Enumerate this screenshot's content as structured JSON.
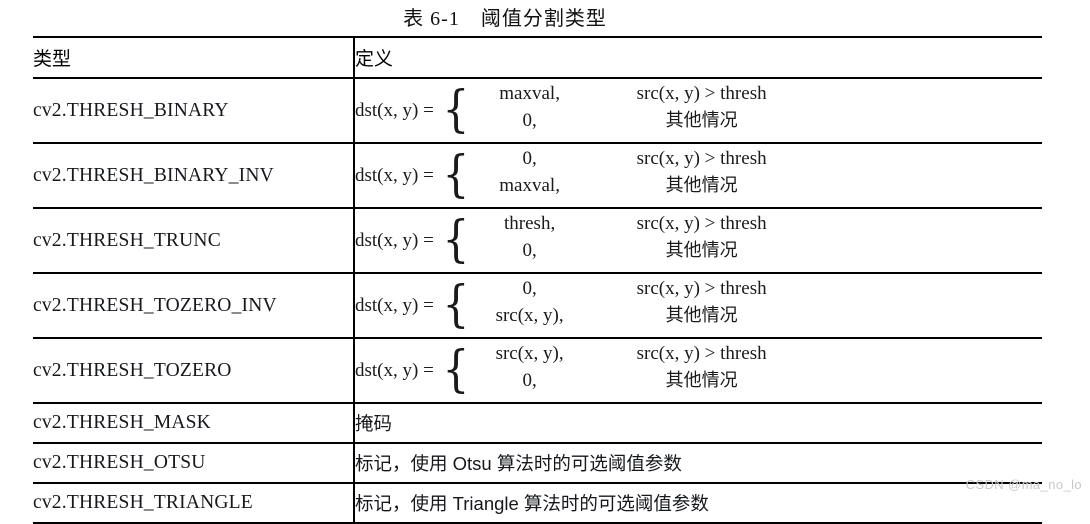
{
  "caption": "表 6-1　阈值分割类型",
  "table": {
    "headers": {
      "type": "类型",
      "definition": "定义"
    },
    "rows": [
      {
        "type": "cv2.THRESH_BINARY",
        "kind": "formula",
        "lhs": "dst(x, y) =",
        "cases": [
          {
            "value": "maxval,",
            "condition": "src(x, y) > thresh"
          },
          {
            "value": "0,",
            "condition": "其他情况"
          }
        ]
      },
      {
        "type": "cv2.THRESH_BINARY_INV",
        "kind": "formula",
        "lhs": "dst(x, y) =",
        "cases": [
          {
            "value": "0,",
            "condition": "src(x, y) > thresh"
          },
          {
            "value": "maxval,",
            "condition": "其他情况"
          }
        ]
      },
      {
        "type": "cv2.THRESH_TRUNC",
        "kind": "formula",
        "lhs": "dst(x, y) =",
        "cases": [
          {
            "value": "thresh,",
            "condition": "src(x, y) > thresh"
          },
          {
            "value": "0,",
            "condition": "其他情况"
          }
        ]
      },
      {
        "type": "cv2.THRESH_TOZERO_INV",
        "kind": "formula",
        "lhs": "dst(x, y) =",
        "cases": [
          {
            "value": "0,",
            "condition": "src(x, y) > thresh"
          },
          {
            "value": "src(x, y),",
            "condition": "其他情况"
          }
        ]
      },
      {
        "type": "cv2.THRESH_TOZERO",
        "kind": "formula",
        "lhs": "dst(x, y) =",
        "cases": [
          {
            "value": "src(x, y),",
            "condition": "src(x, y) > thresh"
          },
          {
            "value": "0,",
            "condition": "其他情况"
          }
        ]
      },
      {
        "type": "cv2.THRESH_MASK",
        "kind": "text",
        "definition": "掩码"
      },
      {
        "type": "cv2.THRESH_OTSU",
        "kind": "text",
        "definition": "标记，使用 Otsu 算法时的可选阈值参数"
      },
      {
        "type": "cv2.THRESH_TRIANGLE",
        "kind": "text",
        "definition": "标记，使用 Triangle 算法时的可选阈值参数"
      }
    ]
  },
  "watermark": "CSDN @ma_no_lo",
  "colors": {
    "border": "#000000",
    "text": "#16181d",
    "watermark": "#c9c9c9",
    "background": "#ffffff"
  }
}
